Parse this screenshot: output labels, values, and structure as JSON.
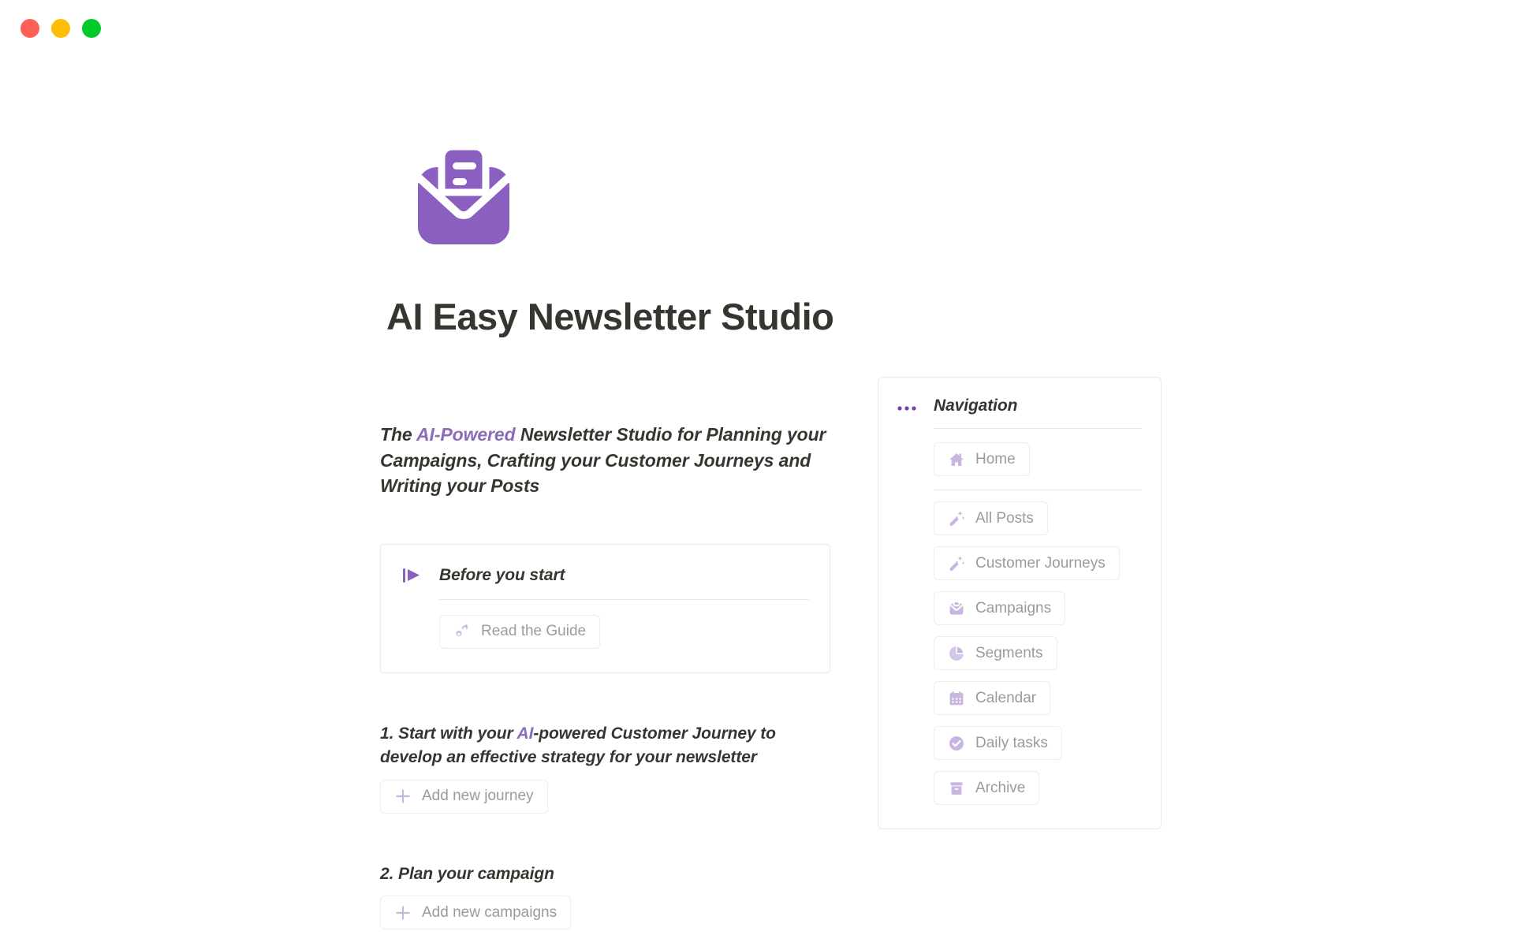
{
  "window": {
    "traffic_lights": [
      {
        "name": "close",
        "color": "#fe5f57"
      },
      {
        "name": "minimize",
        "color": "#ffbd04"
      },
      {
        "name": "maximize",
        "color": "#00c92a"
      }
    ]
  },
  "colors": {
    "brand_purple": "#8b5fbf",
    "accent_text": "#8b6cb8",
    "icon_tint": "#c8b6e0",
    "heading": "#37352f",
    "muted_text": "#9b9b9b",
    "border": "#eaeaea"
  },
  "hero": {
    "icon": "envelope-document-icon",
    "title": "AI Easy Newsletter Studio"
  },
  "lede": {
    "prefix": "The ",
    "accent": "AI-Powered",
    "rest": " Newsletter Studio for Planning your Campaigns, Crafting your Customer Journeys and Writing your Posts"
  },
  "callout": {
    "icon": "flag-icon",
    "title": "Before you start",
    "button": {
      "icon": "gears-icon",
      "label": "Read the Guide"
    }
  },
  "steps": [
    {
      "number": "1.",
      "title_prefix": "1. Start with your ",
      "title_accent": "AI",
      "title_rest": "-powered Customer Journey to develop an effective strategy for your newsletter",
      "button": {
        "icon": "plus-icon",
        "label": "Add new journey"
      }
    },
    {
      "number": "2.",
      "title_prefix": "2. Plan your campaign",
      "title_accent": "",
      "title_rest": "",
      "button": {
        "icon": "plus-icon",
        "label": "Add new campaigns"
      }
    }
  ],
  "navigation": {
    "icon": "three-dots-icon",
    "title": "Navigation",
    "primary": [
      {
        "icon": "home-icon",
        "label": "Home"
      }
    ],
    "items": [
      {
        "icon": "magic-wand-icon",
        "label": "All Posts"
      },
      {
        "icon": "magic-wand-icon",
        "label": "Customer Journeys"
      },
      {
        "icon": "envelope-icon",
        "label": "Campaigns"
      },
      {
        "icon": "pie-chart-icon",
        "label": "Segments"
      },
      {
        "icon": "calendar-icon",
        "label": "Calendar"
      },
      {
        "icon": "check-circle-icon",
        "label": "Daily tasks"
      },
      {
        "icon": "archive-icon",
        "label": "Archive"
      }
    ]
  }
}
